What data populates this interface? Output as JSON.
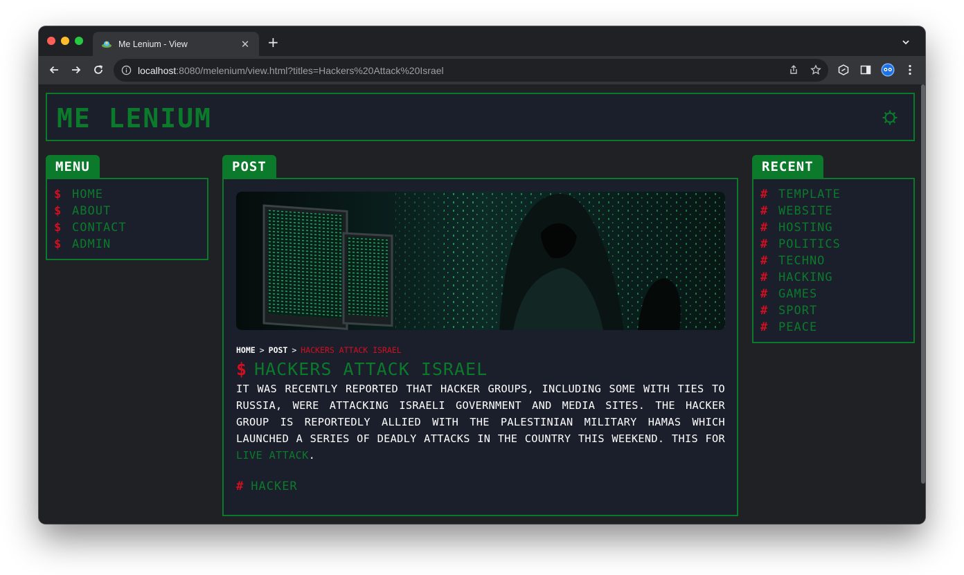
{
  "browser": {
    "tab_title": "Me Lenium - View",
    "url_host": "localhost",
    "url_rest": ":8080/melenium/view.html?titles=Hackers%20Attack%20Israel"
  },
  "site": {
    "logo": "Me Lenium",
    "colors": {
      "accent": "#0b7a2a",
      "alert": "#d01020",
      "panel": "#1b1f2c",
      "background": "#202124"
    }
  },
  "menu": {
    "title": "Menu",
    "symbol": "$",
    "items": [
      {
        "label": "Home"
      },
      {
        "label": "About"
      },
      {
        "label": "Contact"
      },
      {
        "label": "Admin"
      }
    ]
  },
  "post": {
    "section_title": "Post",
    "breadcrumb": {
      "home": "Home",
      "sep1": ">",
      "post": "Post",
      "sep2": ">",
      "current": "Hackers Attack Israel"
    },
    "title_symbol": "$",
    "title": "Hackers Attack Israel",
    "body_text": "It was recently reported that hacker groups, including some with ties to Russia, were attacking Israeli government and media sites. The hacker group is reportedly allied with the Palestinian military Hamas which launched a series of deadly attacks in the country this weekend. This for ",
    "body_link": "live attack",
    "body_end": ".",
    "tag_symbol": "#",
    "tag": "hacker"
  },
  "recent": {
    "title": "Recent",
    "symbol": "#",
    "items": [
      {
        "label": "Template"
      },
      {
        "label": "Website"
      },
      {
        "label": "Hosting"
      },
      {
        "label": "Politics"
      },
      {
        "label": "Techno"
      },
      {
        "label": "Hacking"
      },
      {
        "label": "Games"
      },
      {
        "label": "Sport"
      },
      {
        "label": "Peace"
      }
    ]
  }
}
